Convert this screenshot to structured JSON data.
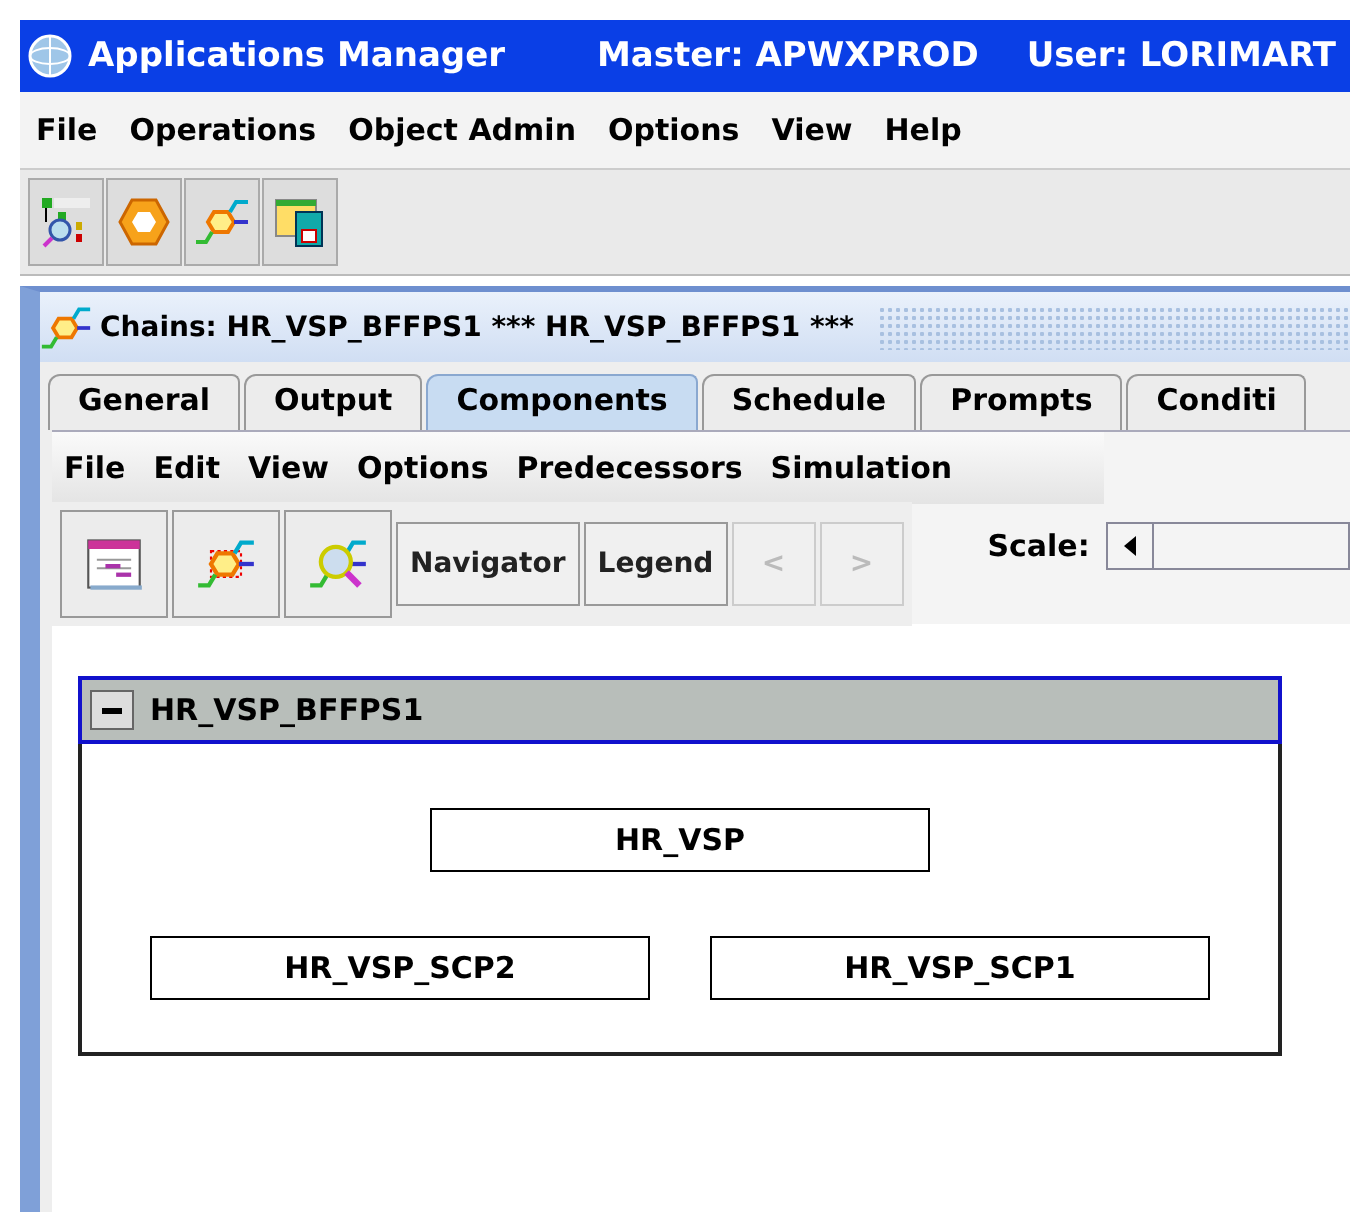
{
  "window": {
    "title": "Applications Manager",
    "master": "Master: APWXPROD",
    "user": "User: LORIMART"
  },
  "menu": [
    "File",
    "Operations",
    "Object Admin",
    "Options",
    "View",
    "Help"
  ],
  "internal_window": {
    "title": "Chains: HR_VSP_BFFPS1 *** HR_VSP_BFFPS1 ***"
  },
  "tabs": [
    {
      "label": "General",
      "selected": false
    },
    {
      "label": "Output",
      "selected": false
    },
    {
      "label": "Components",
      "selected": true
    },
    {
      "label": "Schedule",
      "selected": false
    },
    {
      "label": "Prompts",
      "selected": false
    },
    {
      "label": "Conditi",
      "selected": false
    }
  ],
  "inner_menu": [
    "File",
    "Edit",
    "View",
    "Options",
    "Predecessors",
    "Simulation"
  ],
  "inner_toolbar": {
    "buttons": [
      {
        "label": "Navigator",
        "disabled": false
      },
      {
        "label": "Legend",
        "disabled": false
      },
      {
        "label": "<",
        "disabled": true
      },
      {
        "label": ">",
        "disabled": true
      }
    ],
    "scale_label": "Scale:"
  },
  "group": {
    "title": "HR_VSP_BFFPS1",
    "expanded": true,
    "top_nodes": [
      "HR_VSP"
    ],
    "bottom_nodes": [
      "HR_VSP_SCP2",
      "HR_VSP_SCP1"
    ]
  }
}
